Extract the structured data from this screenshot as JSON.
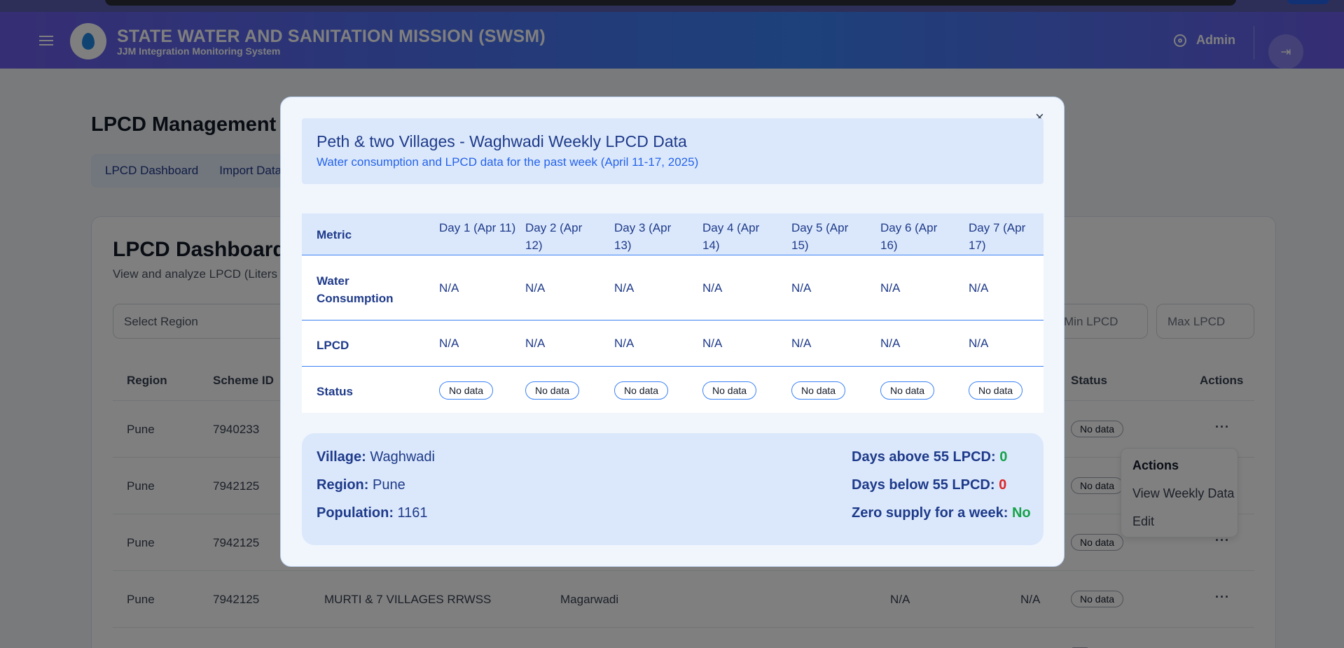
{
  "header": {
    "title": "STATE WATER AND SANITATION MISSION (SWSM)",
    "subtitle": "JJM Integration Monitoring System",
    "user": "Admin"
  },
  "page": {
    "title": "LPCD Management",
    "tabs": [
      "LPCD Dashboard",
      "Import Data"
    ],
    "card_title": "LPCD Dashboard",
    "card_desc": "View and analyze LPCD (Liters P",
    "select_region": "Select Region",
    "min_lpcd": "Min LPCD",
    "max_lpcd": "Max LPCD",
    "columns": {
      "region": "Region",
      "scheme_id": "Scheme ID",
      "status": "Status",
      "actions": "Actions"
    },
    "rows": [
      {
        "region": "Pune",
        "scheme_id": "7940233",
        "scheme": "",
        "village": "",
        "v1": "",
        "v2": "",
        "status": "No data"
      },
      {
        "region": "Pune",
        "scheme_id": "7942125",
        "scheme": "",
        "village": "",
        "v1": "",
        "v2": "",
        "status": "No data"
      },
      {
        "region": "Pune",
        "scheme_id": "7942125",
        "scheme": "",
        "village": "",
        "v1": "",
        "v2": "",
        "status": "No data"
      },
      {
        "region": "Pune",
        "scheme_id": "7942125",
        "scheme": "MURTI & 7 VILLAGES RRWSS",
        "village": "Magarwadi",
        "v1": "N/A",
        "v2": "N/A",
        "status": "No data"
      }
    ]
  },
  "dropdown": {
    "header": "Actions",
    "items": [
      "View Weekly Data",
      "Edit"
    ]
  },
  "modal": {
    "title": "Peth & two Villages - Waghwadi Weekly LPCD Data",
    "subtitle": "Water consumption and LPCD data for the past week (April 11-17, 2025)",
    "close": "×",
    "metric_header": "Metric",
    "days": [
      "Day 1 (Apr 11)",
      "Day 2 (Apr 12)",
      "Day 3 (Apr 13)",
      "Day 4 (Apr 14)",
      "Day 5 (Apr 15)",
      "Day 6 (Apr 16)",
      "Day 7 (Apr 17)"
    ],
    "metrics": {
      "water_consumption": {
        "label": "Water Consumption",
        "values": [
          "N/A",
          "N/A",
          "N/A",
          "N/A",
          "N/A",
          "N/A",
          "N/A"
        ]
      },
      "lpcd": {
        "label": "LPCD",
        "values": [
          "N/A",
          "N/A",
          "N/A",
          "N/A",
          "N/A",
          "N/A",
          "N/A"
        ]
      },
      "status": {
        "label": "Status",
        "values": [
          "No data",
          "No data",
          "No data",
          "No data",
          "No data",
          "No data",
          "No data"
        ]
      }
    },
    "summary": {
      "village_label": "Village:",
      "village": "Waghwadi",
      "region_label": "Region:",
      "region": "Pune",
      "population_label": "Population:",
      "population": "1161",
      "above_label": "Days above 55 LPCD:",
      "above": "0",
      "below_label": "Days below 55 LPCD:",
      "below": "0",
      "zero_label": "Zero supply for a week:",
      "zero": "No"
    }
  }
}
